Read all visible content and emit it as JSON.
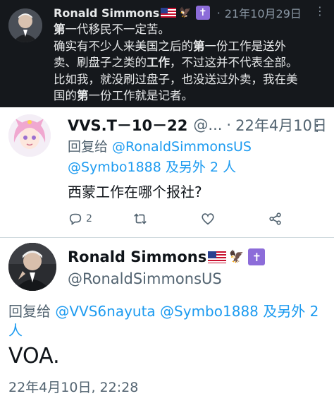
{
  "top_tweet": {
    "name": "Ronald Simmons",
    "flag": "🇺🇸",
    "badge_eagle": "🦅",
    "badge_cross": "✝",
    "separator": "·",
    "date": "21年10月29日",
    "more": "⋮",
    "line1_bold": "第",
    "line1_rest": "一代移民不一定苦。",
    "line2_a": "确实有不少人来美国之后的",
    "line2_b_bold": "第",
    "line2_c": "一份工作是送外",
    "line3_a": "卖、刷盘子之类的",
    "line3_b_bold": "工作",
    "line3_c": "，不过这并不代表全部。",
    "line4": "比如我，就没刷过盘子，也没送过外卖，我在美",
    "line5_a": "国的",
    "line5_b_bold": "第",
    "line5_c": "一份工作就是记者。"
  },
  "reply_tweet": {
    "name": "VVS.T－10－22",
    "handle": "@...",
    "separator": "·",
    "date": "22年4月10日",
    "more": "⋮",
    "replying_prefix": "回复给 ",
    "replying_user1": "@RonaldSimmonsUS",
    "replying_user2": "@Symbo1888",
    "replying_others": " 及另外 2 人",
    "text": "西蒙工作在哪个报社?",
    "reply_count": "2"
  },
  "main_tweet": {
    "name": "Ronald Simmons",
    "flag": "🇺🇸",
    "badge_eagle": "🦅",
    "badge_cross": "✝",
    "handle": "@RonaldSimmonsUS",
    "replying_prefix": "回复给 ",
    "replying_user1": "@VVS6nayuta",
    "replying_user2": "@Symbo1888",
    "replying_others_a": " 及另外 2",
    "replying_others_b": "人",
    "text": "VOA.",
    "timestamp": "22年4月10日, 22:28"
  },
  "colors": {
    "dark_bg": "#15181c",
    "link": "#1d9bf0",
    "muted": "#536471"
  }
}
